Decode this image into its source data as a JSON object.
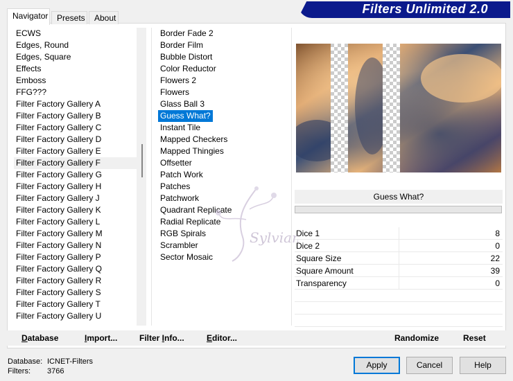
{
  "app": {
    "title": "Filters Unlimited 2.0"
  },
  "tabs": [
    {
      "label": "Navigator",
      "active": true
    },
    {
      "label": "Presets",
      "active": false
    },
    {
      "label": "About",
      "active": false
    }
  ],
  "categories": {
    "items": [
      "ECWS",
      "Edges, Round",
      "Edges, Square",
      "Effects",
      "Emboss",
      "FFG???",
      "Filter Factory Gallery A",
      "Filter Factory Gallery B",
      "Filter Factory Gallery C",
      "Filter Factory Gallery D",
      "Filter Factory Gallery E",
      "Filter Factory Gallery F",
      "Filter Factory Gallery G",
      "Filter Factory Gallery H",
      "Filter Factory Gallery J",
      "Filter Factory Gallery K",
      "Filter Factory Gallery L",
      "Filter Factory Gallery M",
      "Filter Factory Gallery N",
      "Filter Factory Gallery P",
      "Filter Factory Gallery Q",
      "Filter Factory Gallery R",
      "Filter Factory Gallery S",
      "Filter Factory Gallery T",
      "Filter Factory Gallery U"
    ],
    "selected": "Filter Factory Gallery F"
  },
  "filters": {
    "items": [
      "Border Fade 2",
      "Border Film",
      "Bubble Distort",
      "Color Reductor",
      "Flowers 2",
      "Flowers",
      "Glass Ball 3",
      "Guess What?",
      "Instant Tile",
      "Mapped Checkers",
      "Mapped Thingies",
      "Offsetter",
      "Patch Work",
      "Patches",
      "Patchwork",
      "Quadrant Replicate",
      "Radial Replicate",
      "RGB Spirals",
      "Scrambler",
      "Sector Mosaic"
    ],
    "selected": "Guess What?"
  },
  "preview": {
    "filter_name": "Guess What?"
  },
  "params": [
    {
      "name": "Dice 1",
      "value": "8"
    },
    {
      "name": "Dice 2",
      "value": "0"
    },
    {
      "name": "Square Size",
      "value": "22"
    },
    {
      "name": "Square Amount",
      "value": "39"
    },
    {
      "name": "Transparency",
      "value": "0"
    }
  ],
  "toolbar": {
    "database_u": "D",
    "database_rest": "atabase",
    "import_u": "I",
    "import_rest": "mport...",
    "filterinfo_pre": "Filter ",
    "filterinfo_u": "I",
    "filterinfo_rest": "nfo...",
    "editor_u": "E",
    "editor_rest": "ditor...",
    "randomize": "Randomize",
    "reset": "Reset"
  },
  "status": {
    "database_label": "Database:",
    "database_value": "ICNET-Filters",
    "filters_label": "Filters:",
    "filters_value": "3766"
  },
  "buttons": {
    "apply": "Apply",
    "cancel": "Cancel",
    "help": "Help"
  },
  "watermark": {
    "text": "Sylviane"
  },
  "colors": {
    "banner": "#0b1a8c",
    "selection": "#0078d7"
  }
}
